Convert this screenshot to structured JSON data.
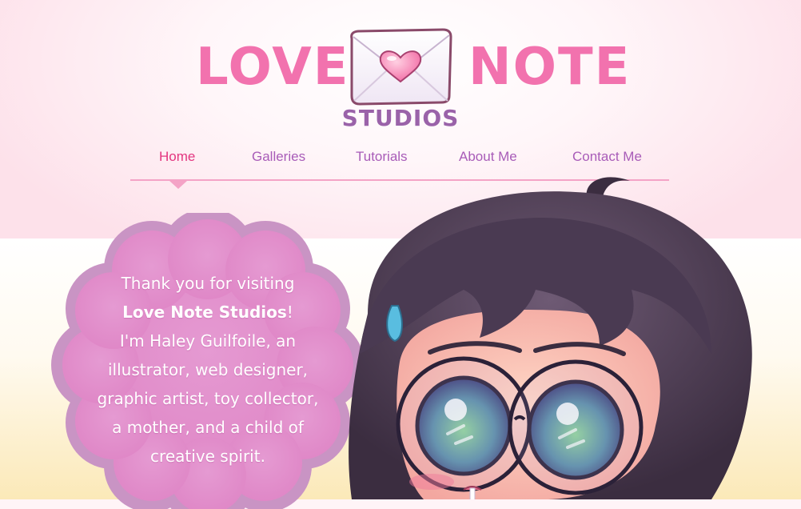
{
  "logo": {
    "word_left": "LOVE",
    "word_right": "NOTE",
    "subtitle": "STUDIOS",
    "envelope_icon": "envelope-heart-icon",
    "brand_pink": "#f272ae",
    "brand_purple": "#9a62a9"
  },
  "nav": {
    "items": [
      {
        "label": "Home",
        "active": true
      },
      {
        "label": "Galleries"
      },
      {
        "label": "Tutorials"
      },
      {
        "label": "About Me"
      },
      {
        "label": "Contact Me"
      }
    ],
    "active_color": "#e3357f",
    "color": "#a85cb8"
  },
  "intro": {
    "line1": "Thank you for visiting",
    "line2": "Love Note Studios",
    "line2_punct": "!",
    "line3": "I'm Haley Guilfoile, an",
    "line4": "illustrator, web designer,",
    "line5": "graphic artist, toy collector,",
    "line6": "a mother, and a child of",
    "line7": "creative spirit."
  },
  "character": {
    "image_name": "chibi-girl-with-glasses-illustration"
  }
}
